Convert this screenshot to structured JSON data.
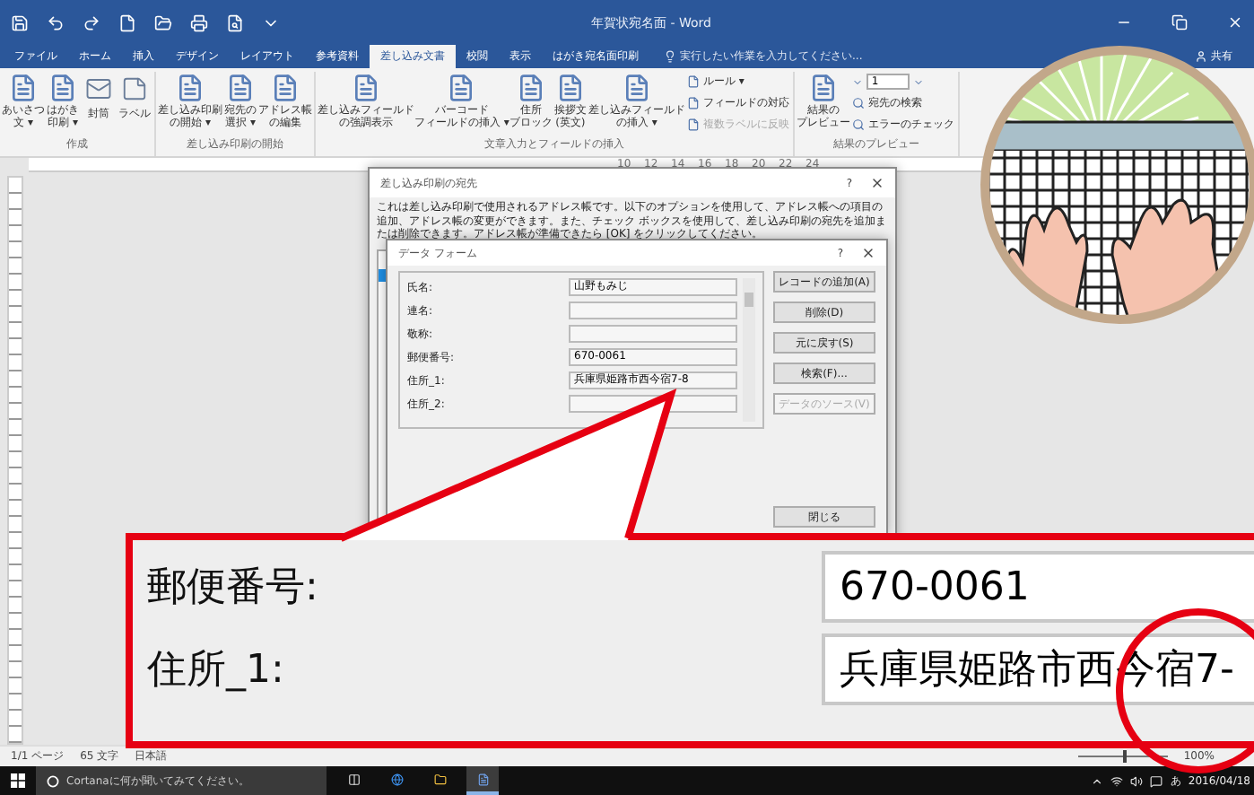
{
  "window": {
    "title": "年賀状宛名面 - Word"
  },
  "tabs": [
    {
      "label": "ファイル",
      "selected": false
    },
    {
      "label": "ホーム",
      "selected": false
    },
    {
      "label": "挿入",
      "selected": false
    },
    {
      "label": "デザイン",
      "selected": false
    },
    {
      "label": "レイアウト",
      "selected": false
    },
    {
      "label": "参考資料",
      "selected": false
    },
    {
      "label": "差し込み文書",
      "selected": true
    },
    {
      "label": "校閲",
      "selected": false
    },
    {
      "label": "表示",
      "selected": false
    },
    {
      "label": "はがき宛名面印刷",
      "selected": false
    }
  ],
  "tell_me": "実行したい作業を入力してください...",
  "share": "共有",
  "ribbon": {
    "groups": [
      {
        "label": "作成",
        "items": [
          {
            "kind": "large",
            "lines": [
              "あいさつ",
              "文 ▾"
            ]
          },
          {
            "kind": "large",
            "lines": [
              "はがき",
              "印刷 ▾"
            ]
          },
          {
            "kind": "envelope",
            "lines": [
              "封筒"
            ]
          },
          {
            "kind": "label",
            "lines": [
              "ラベル"
            ]
          }
        ]
      },
      {
        "label": "差し込み印刷の開始",
        "items": [
          {
            "kind": "large",
            "lines": [
              "差し込み印刷",
              "の開始 ▾"
            ]
          },
          {
            "kind": "large",
            "lines": [
              "宛先の",
              "選択 ▾"
            ]
          },
          {
            "kind": "large",
            "lines": [
              "アドレス帳",
              "の編集"
            ]
          }
        ]
      },
      {
        "label": "文章入力とフィールドの挿入",
        "items": [
          {
            "kind": "large",
            "lines": [
              "差し込みフィールド",
              "の強調表示"
            ]
          },
          {
            "kind": "large",
            "lines": [
              "バーコード",
              "フィールドの挿入 ▾"
            ]
          },
          {
            "kind": "large",
            "lines": [
              "住所",
              "ブロック"
            ]
          },
          {
            "kind": "large",
            "lines": [
              "挨拶文",
              "(英文)"
            ]
          },
          {
            "kind": "large",
            "lines": [
              "差し込みフィールド",
              "の挿入 ▾"
            ]
          },
          {
            "kind": "stack",
            "items": [
              {
                "label": "ルール ▾",
                "disabled": false
              },
              {
                "label": "フィールドの対応",
                "disabled": false
              },
              {
                "label": "複数ラベルに反映",
                "disabled": true
              }
            ]
          }
        ]
      },
      {
        "label": "結果のプレビュー",
        "items": [
          {
            "kind": "large",
            "lines": [
              "結果の",
              "プレビュー"
            ]
          },
          {
            "kind": "nav",
            "record": "1",
            "items": [
              {
                "label": "宛先の検索",
                "disabled": false
              },
              {
                "label": "エラーのチェック",
                "disabled": false
              }
            ]
          }
        ]
      }
    ]
  },
  "ruler": {
    "numbers": [
      "10",
      "12",
      "14",
      "16",
      "18",
      "20",
      "22",
      "24"
    ]
  },
  "dialog": {
    "title": "差し込み印刷の宛先",
    "help": "?",
    "description": "これは差し込み印刷で使用されるアドレス帳です。以下のオプションを使用して、アドレス帳への項目の追加、アドレス帳の変更ができます。また、チェック ボックスを使用して、差し込み印刷の宛先を追加または削除できます。アドレス帳が準備できたら [OK] をクリックしてください。"
  },
  "data_form": {
    "title": "データ フォーム",
    "help": "?",
    "fields": [
      {
        "label": "氏名:",
        "value": "山野もみじ"
      },
      {
        "label": "連名:"
      },
      {
        "label": "敬称:"
      },
      {
        "label": "郵便番号:",
        "value": "670-0061"
      },
      {
        "label": "住所_1:",
        "value": "兵庫県姫路市西今宿7-8"
      },
      {
        "label": "住所_2:"
      }
    ],
    "buttons": [
      {
        "label": "レコードの追加(A)",
        "disabled": false
      },
      {
        "label": "削除(D)",
        "disabled": false
      },
      {
        "label": "元に戻す(S)",
        "disabled": false
      },
      {
        "label": "検索(F)...",
        "disabled": false
      },
      {
        "label": "データのソース(V)",
        "disabled": true
      }
    ],
    "close": "閉じる"
  },
  "callout": {
    "fields": [
      {
        "label": "郵便番号:",
        "value": "670-0061"
      },
      {
        "label": "住所_1:",
        "value": "兵庫県姫路市西今宿7-"
      }
    ]
  },
  "status_bar": {
    "items": [
      "1/1 ページ",
      "65 文字",
      "日本語"
    ],
    "zoom_slider": {
      "level": 0.5
    },
    "zoom": "100%"
  },
  "taskbar": {
    "search_placeholder": "Cortanaに何か聞いてみてください。",
    "apps": [
      {
        "kind": "task-view",
        "selected": false
      },
      {
        "kind": "edge",
        "selected": false
      },
      {
        "kind": "explorer",
        "selected": false
      },
      {
        "kind": "word",
        "selected": true
      }
    ],
    "ime": "あ",
    "date": "2016/04/18"
  }
}
